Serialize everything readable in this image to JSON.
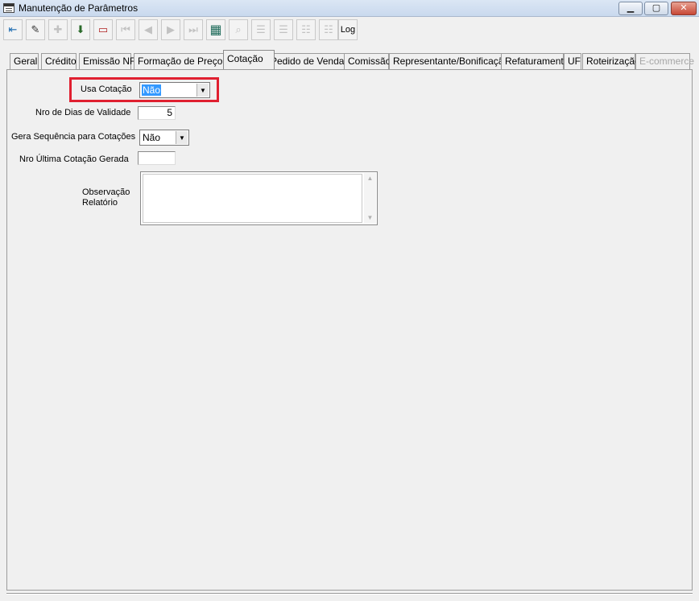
{
  "window": {
    "title": "Manutenção de Parâmetros",
    "minimize": "▁",
    "maximize": "▢",
    "close": "✕"
  },
  "toolbar": {
    "buttons": [
      {
        "icon": "exit-icon",
        "glyph": "⇤",
        "enabled": true
      },
      {
        "icon": "eraser-icon",
        "glyph": "✎",
        "enabled": true
      },
      {
        "icon": "new-record-icon",
        "glyph": "✚",
        "enabled": false
      },
      {
        "icon": "save-icon",
        "glyph": "⬇",
        "enabled": true
      },
      {
        "icon": "open-icon",
        "glyph": "▭",
        "enabled": true
      },
      {
        "icon": "first-record-icon",
        "glyph": "⏮",
        "enabled": false
      },
      {
        "icon": "prev-record-icon",
        "glyph": "◀",
        "enabled": false
      },
      {
        "icon": "next-record-icon",
        "glyph": "▶",
        "enabled": false
      },
      {
        "icon": "last-record-icon",
        "glyph": "⏭",
        "enabled": false
      },
      {
        "icon": "print-icon",
        "glyph": "▦",
        "enabled": true
      },
      {
        "icon": "search-icon",
        "glyph": "⌕",
        "enabled": false
      },
      {
        "icon": "grid-1-icon",
        "glyph": "☰",
        "enabled": false
      },
      {
        "icon": "grid-2-icon",
        "glyph": "☰",
        "enabled": false
      },
      {
        "icon": "grid-3-icon",
        "glyph": "☷",
        "enabled": false
      },
      {
        "icon": "grid-4-icon",
        "glyph": "☷",
        "enabled": false
      }
    ],
    "log_label": "Log"
  },
  "tabs": [
    {
      "label": "Geral",
      "active": false,
      "disabled": false
    },
    {
      "label": "Crédito",
      "active": false,
      "disabled": false
    },
    {
      "label": "Emissão NF",
      "active": false,
      "disabled": false
    },
    {
      "label": "Formação de Preço",
      "active": false,
      "disabled": false
    },
    {
      "label": "Cotação",
      "active": true,
      "disabled": false
    },
    {
      "label": "Pedido de Venda",
      "active": false,
      "disabled": false
    },
    {
      "label": "Comissão",
      "active": false,
      "disabled": false
    },
    {
      "label": "Representante/Bonificação",
      "active": false,
      "disabled": false
    },
    {
      "label": "Refaturamento",
      "active": false,
      "disabled": false
    },
    {
      "label": "UF",
      "active": false,
      "disabled": false
    },
    {
      "label": "Roteirização",
      "active": false,
      "disabled": false
    },
    {
      "label": "E-commerce",
      "active": false,
      "disabled": true
    }
  ],
  "form": {
    "usa_cotacao_label": "Usa Cotação",
    "usa_cotacao_value": "Não",
    "dias_validade_label": "Nro de Dias de Validade",
    "dias_validade_value": "5",
    "gera_sequencia_label": "Gera Sequência para Cotações",
    "gera_sequencia_value": "Não",
    "ultima_cotacao_label": "Nro Última Cotação Gerada",
    "ultima_cotacao_value": "",
    "observacao_label_1": "Observação",
    "observacao_label_2": "Relatório",
    "observacao_value": ""
  },
  "colors": {
    "highlight": "#e02030",
    "selection": "#3399ff"
  }
}
